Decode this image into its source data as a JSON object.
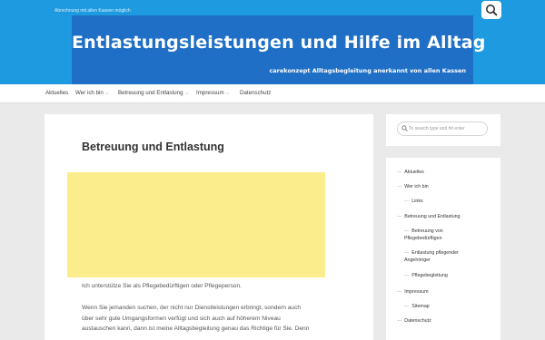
{
  "header": {
    "tagline": "Abrechnung mit allen Kassen möglich",
    "banner_title": "Entlastungsleistungen und Hilfe im Alltag",
    "banner_subtitle": "carekonzept Alltagsbegleitung anerkannt von allen Kassen",
    "colors": {
      "topbar": "#1e9be0",
      "banner": "#1e6fc5"
    }
  },
  "nav": {
    "items": [
      {
        "label": "Aktuelles",
        "has_dropdown": false
      },
      {
        "label": "Wer ich bin",
        "has_dropdown": true
      },
      {
        "label": "Betreuung und Entlastung",
        "has_dropdown": true
      },
      {
        "label": "Impressum",
        "has_dropdown": true
      },
      {
        "label": "Datenschutz",
        "has_dropdown": false
      }
    ]
  },
  "main": {
    "title": "Betreuung und Entlastung",
    "paragraphs": [
      "Ich unterstütze Sie als Pflegebedürftigen oder Pflegeperson.",
      "Wenn Sie jemanden suchen, der nicht nur Dienstleistungen erbringt, sondern auch",
      "über sehr gute Umgangsformen verfügt und sich auch auf höherem Niveau",
      "austauschen kann, dann ist meine Alltagsbegleitung genau das Richtige für Sie. Denn"
    ],
    "ad_color": "#fbed8b"
  },
  "sidebar": {
    "search_placeholder": "To search type and hit enter",
    "menu": [
      {
        "label": "Aktuelles",
        "level": 1
      },
      {
        "label": "Wer ich bin",
        "level": 1
      },
      {
        "label": "Links",
        "level": 2
      },
      {
        "label": "Betreuung und Entlastung",
        "level": 1
      },
      {
        "label": "Betreuung von",
        "label2": "Pflegebedürftigen",
        "level": 2
      },
      {
        "label": "Entlastung pflegender",
        "label2": "Angehöriger",
        "level": 2
      },
      {
        "label": "Pflegebegleitung",
        "level": 2
      },
      {
        "label": "Impressum",
        "level": 1
      },
      {
        "label": "Sitemap",
        "level": 2
      },
      {
        "label": "Datenschutz",
        "level": 1
      }
    ]
  }
}
